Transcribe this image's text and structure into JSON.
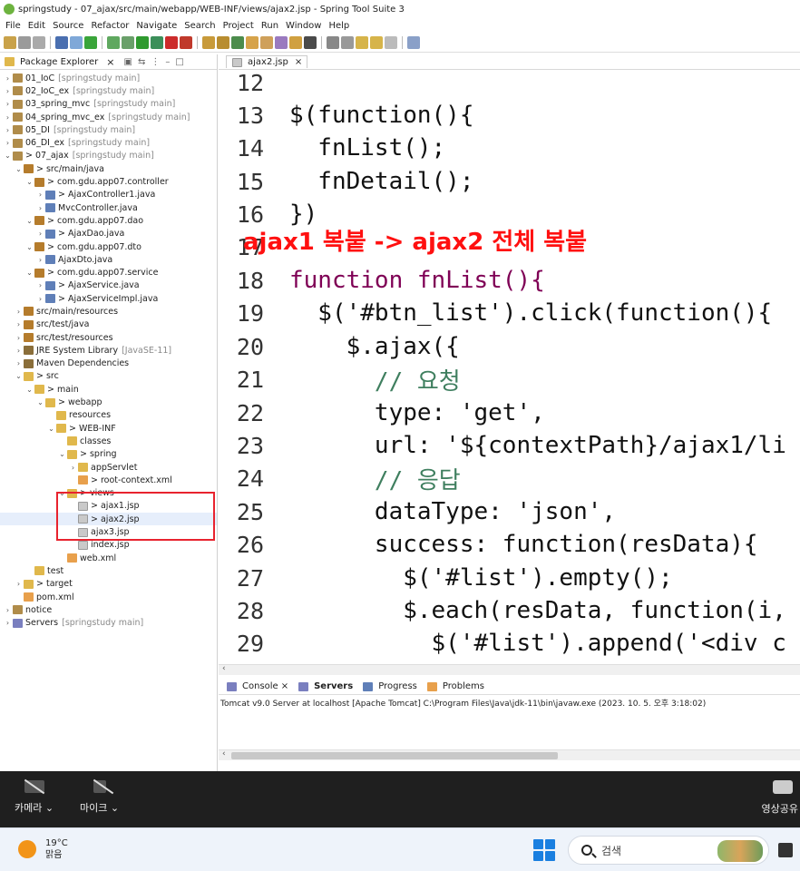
{
  "window": {
    "title": "springstudy - 07_ajax/src/main/webapp/WEB-INF/views/ajax2.jsp - Spring Tool Suite 3"
  },
  "menu": [
    "File",
    "Edit",
    "Source",
    "Refactor",
    "Navigate",
    "Search",
    "Project",
    "Run",
    "Window",
    "Help"
  ],
  "package_explorer": {
    "tab_label": "Package Explorer",
    "tree": [
      {
        "label": "01_IoC",
        "note": "[springstudy main]"
      },
      {
        "label": "02_IoC_ex",
        "note": "[springstudy main]"
      },
      {
        "label": "03_spring_mvc",
        "note": "[springstudy main]"
      },
      {
        "label": "04_spring_mvc_ex",
        "note": "[springstudy main]"
      },
      {
        "label": "05_DI",
        "note": "[springstudy main]"
      },
      {
        "label": "06_DI_ex",
        "note": "[springstudy main]"
      },
      {
        "label": "> 07_ajax",
        "note": "[springstudy main]"
      },
      {
        "label": "> src/main/java",
        "note": ""
      },
      {
        "label": "> com.gdu.app07.controller",
        "note": ""
      },
      {
        "label": "> AjaxController1.java",
        "note": ""
      },
      {
        "label": "MvcController.java",
        "note": ""
      },
      {
        "label": "> com.gdu.app07.dao",
        "note": ""
      },
      {
        "label": "> AjaxDao.java",
        "note": ""
      },
      {
        "label": "> com.gdu.app07.dto",
        "note": ""
      },
      {
        "label": "AjaxDto.java",
        "note": ""
      },
      {
        "label": "> com.gdu.app07.service",
        "note": ""
      },
      {
        "label": "> AjaxService.java",
        "note": ""
      },
      {
        "label": "> AjaxServiceImpl.java",
        "note": ""
      },
      {
        "label": "src/main/resources",
        "note": ""
      },
      {
        "label": "src/test/java",
        "note": ""
      },
      {
        "label": "src/test/resources",
        "note": ""
      },
      {
        "label": "JRE System Library",
        "note": "[JavaSE-11]"
      },
      {
        "label": "Maven Dependencies",
        "note": ""
      },
      {
        "label": "> src",
        "note": ""
      },
      {
        "label": "> main",
        "note": ""
      },
      {
        "label": "> webapp",
        "note": ""
      },
      {
        "label": "resources",
        "note": ""
      },
      {
        "label": "> WEB-INF",
        "note": ""
      },
      {
        "label": "classes",
        "note": ""
      },
      {
        "label": "> spring",
        "note": ""
      },
      {
        "label": "appServlet",
        "note": ""
      },
      {
        "label": "> root-context.xml",
        "note": ""
      },
      {
        "label": "> views",
        "note": ""
      },
      {
        "label": "> ajax1.jsp",
        "note": ""
      },
      {
        "label": "> ajax2.jsp",
        "note": ""
      },
      {
        "label": "ajax3.jsp",
        "note": ""
      },
      {
        "label": "index.jsp",
        "note": ""
      },
      {
        "label": "web.xml",
        "note": ""
      },
      {
        "label": "test",
        "note": ""
      },
      {
        "label": "> target",
        "note": ""
      },
      {
        "label": "pom.xml",
        "note": ""
      },
      {
        "label": "notice",
        "note": ""
      },
      {
        "label": "Servers",
        "note": "[springstudy main]"
      }
    ]
  },
  "editor": {
    "tab_label": "ajax2.jsp",
    "overlay_text": "ajax1 복붙 -> ajax2 전체 복붙",
    "lines": [
      {
        "n": "12",
        "code": ""
      },
      {
        "n": "13",
        "code": "$(function(){"
      },
      {
        "n": "14",
        "code": "  fnList();"
      },
      {
        "n": "15",
        "code": "  fnDetail();"
      },
      {
        "n": "16",
        "code": "})"
      },
      {
        "n": "17",
        "code": ""
      },
      {
        "n": "18",
        "code": "function fnList(){"
      },
      {
        "n": "19",
        "code": "  $('#btn_list').click(function(){"
      },
      {
        "n": "20",
        "code": "    $.ajax({"
      },
      {
        "n": "21",
        "code": "      // 요청"
      },
      {
        "n": "22",
        "code": "      type: 'get',"
      },
      {
        "n": "23",
        "code": "      url: '${contextPath}/ajax1/li"
      },
      {
        "n": "24",
        "code": "      // 응답"
      },
      {
        "n": "25",
        "code": "      dataType: 'json',"
      },
      {
        "n": "26",
        "code": "      success: function(resData){"
      },
      {
        "n": "27",
        "code": "        $('#list').empty();"
      },
      {
        "n": "28",
        "code": "        $.each(resData, function(i,"
      },
      {
        "n": "29",
        "code": "          $('#list').append('<div c"
      }
    ]
  },
  "console": {
    "tabs": [
      "Console",
      "Servers",
      "Progress",
      "Problems"
    ],
    "status_line": "Tomcat v9.0 Server at localhost [Apache Tomcat] C:\\Program Files\\Java\\jdk-11\\bin\\javaw.exe  (2023. 10. 5. 오후 3:18:02)"
  },
  "call_bar": {
    "camera_label": "카메라 ⌄",
    "mic_label": "마이크 ⌄",
    "share_label": "영상공유"
  },
  "taskbar": {
    "temperature": "19°C",
    "weather": "맑음",
    "search_placeholder": "검색"
  }
}
